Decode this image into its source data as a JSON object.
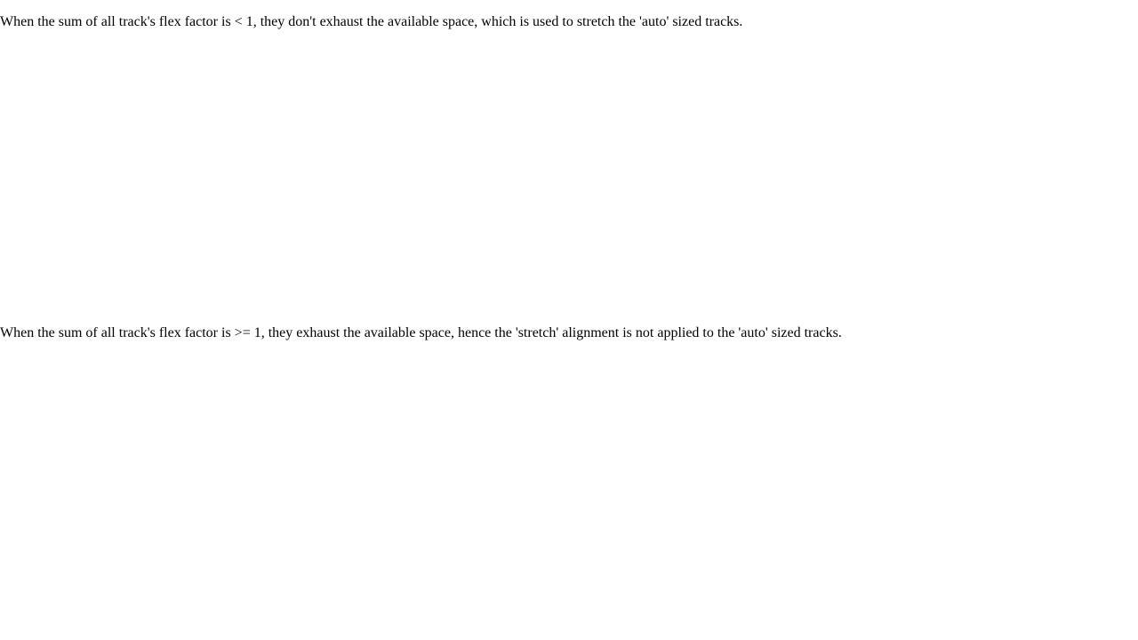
{
  "paragraphs": [
    "When the sum of all track's flex factor is < 1, they don't exhaust the available space, which is used to stretch the 'auto' sized tracks.",
    "When the sum of all track's flex factor is >= 1, they exhaust the available space, hence the 'stretch' alignment is not applied to the 'auto' sized tracks."
  ],
  "colors": {
    "background": "#ffffff",
    "text": "#000000"
  }
}
